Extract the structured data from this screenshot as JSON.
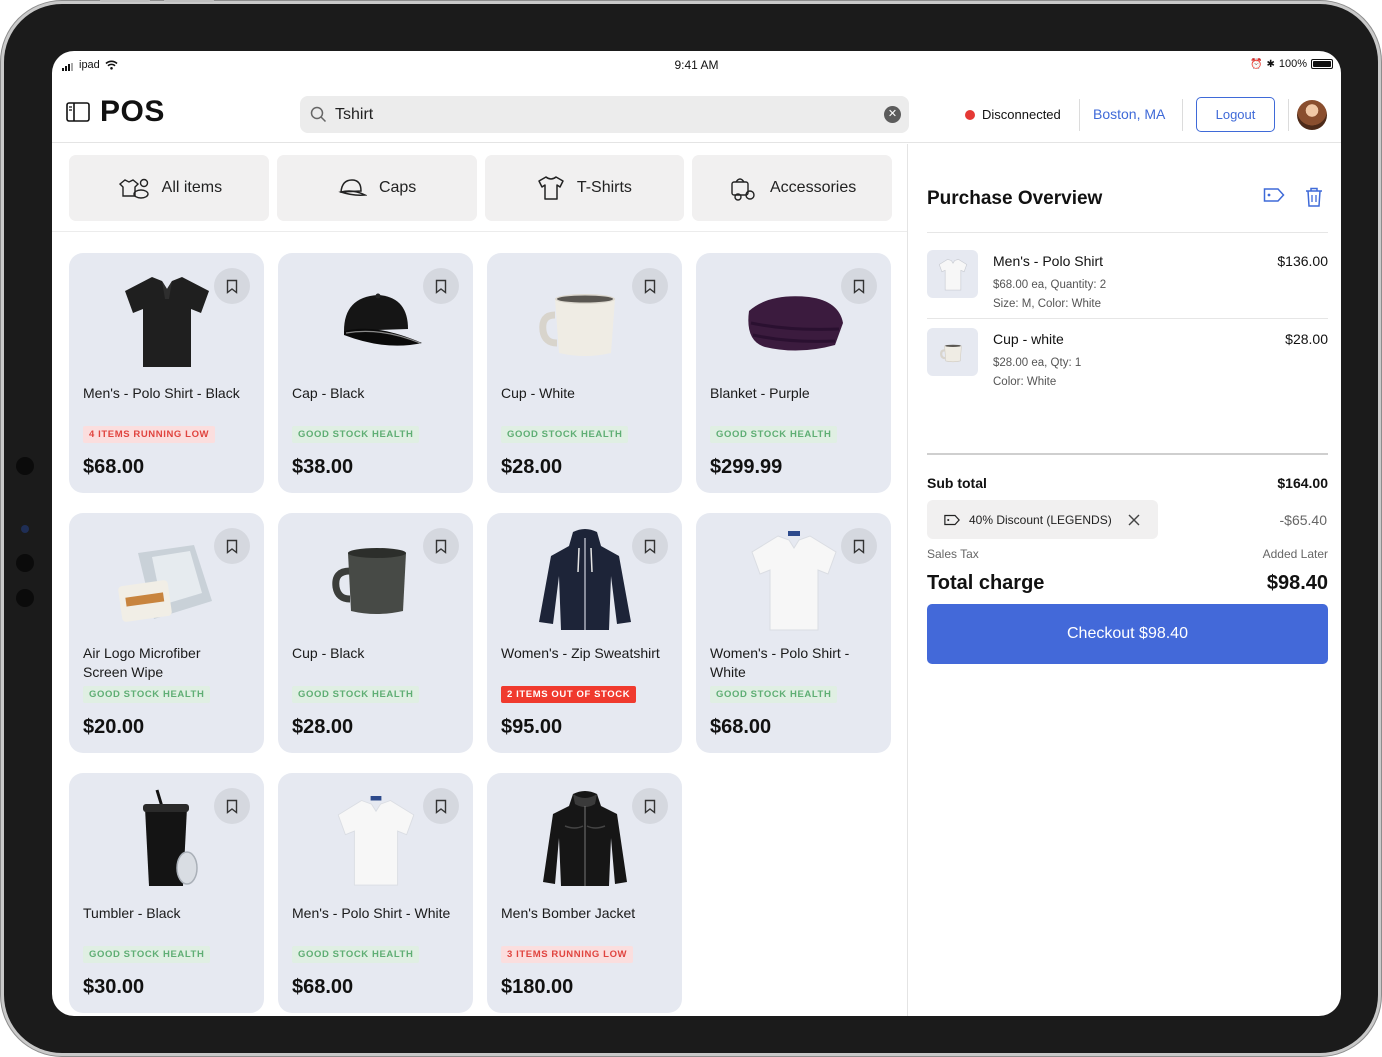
{
  "status_bar": {
    "carrier": "ipad",
    "time": "9:41 AM",
    "battery": "100%"
  },
  "header": {
    "title": "POS",
    "search": {
      "value": "Tshirt",
      "placeholder": ""
    },
    "connection": "Disconnected",
    "location": "Boston, MA",
    "logout_label": "Logout"
  },
  "categories": [
    {
      "label": "All items",
      "icon": "all-items-icon"
    },
    {
      "label": "Caps",
      "icon": "cap-icon"
    },
    {
      "label": "T-Shirts",
      "icon": "tshirt-icon"
    },
    {
      "label": "Accessories",
      "icon": "accessories-icon"
    }
  ],
  "products": [
    {
      "name": "Men's - Polo Shirt - Black",
      "badge": "4 ITEMS RUNNING LOW",
      "badge_type": "low",
      "price": "$68.00",
      "image": "polo-shirt-black"
    },
    {
      "name": "Cap - Black",
      "badge": "GOOD STOCK HEALTH",
      "badge_type": "good",
      "price": "$38.00",
      "image": "cap-black"
    },
    {
      "name": "Cup - White",
      "badge": "GOOD STOCK HEALTH",
      "badge_type": "good",
      "price": "$28.00",
      "image": "cup-white"
    },
    {
      "name": "Blanket - Purple",
      "badge": "GOOD STOCK HEALTH",
      "badge_type": "good",
      "price": "$299.99",
      "image": "blanket-purple"
    },
    {
      "name": "Air Logo Microfiber Screen Wipe",
      "badge": "GOOD STOCK HEALTH",
      "badge_type": "good",
      "price": "$20.00",
      "image": "microfiber-wipe"
    },
    {
      "name": "Cup - Black",
      "badge": "GOOD STOCK HEALTH",
      "badge_type": "good",
      "price": "$28.00",
      "image": "cup-black"
    },
    {
      "name": "Women's - Zip Sweatshirt",
      "badge": "2 ITEMS OUT OF STOCK",
      "badge_type": "out",
      "price": "$95.00",
      "image": "zip-sweatshirt"
    },
    {
      "name": "Women's - Polo Shirt - White",
      "badge": "GOOD STOCK HEALTH",
      "badge_type": "good",
      "price": "$68.00",
      "image": "polo-shirt-white"
    },
    {
      "name": "Tumbler - Black",
      "badge": "GOOD STOCK HEALTH",
      "badge_type": "good",
      "price": "$30.00",
      "image": "tumbler-black"
    },
    {
      "name": "Men's - Polo Shirt - White",
      "badge": "GOOD STOCK HEALTH",
      "badge_type": "good",
      "price": "$68.00",
      "image": "polo-shirt-white"
    },
    {
      "name": "Men's Bomber Jacket",
      "badge": "3 ITEMS RUNNING LOW",
      "badge_type": "low",
      "price": "$180.00",
      "image": "bomber-jacket"
    }
  ],
  "purchase": {
    "title": "Purchase Overview",
    "items": [
      {
        "name": "Men's - Polo Shirt",
        "line1": "$68.00 ea,  Quantity:  2",
        "line2": "Size:  M,   Color:  White",
        "price": "$136.00"
      },
      {
        "name": "Cup - white",
        "line1": "$28.00 ea,  Qty:  1",
        "line2": "Color:  White",
        "price": "$28.00"
      }
    ],
    "subtotal_label": "Sub total",
    "subtotal": "$164.00",
    "discount_label": "40% Discount (LEGENDS)",
    "discount_value": "-$65.40",
    "tax_label": "Sales Tax",
    "tax_value": "Added Later",
    "total_label": "Total charge",
    "total": "$98.40",
    "checkout_label": "Checkout $98.40"
  },
  "colors": {
    "accent": "#4369d9",
    "card": "#e6e9f1",
    "good": "#5fae74",
    "low": "#e0443f"
  }
}
